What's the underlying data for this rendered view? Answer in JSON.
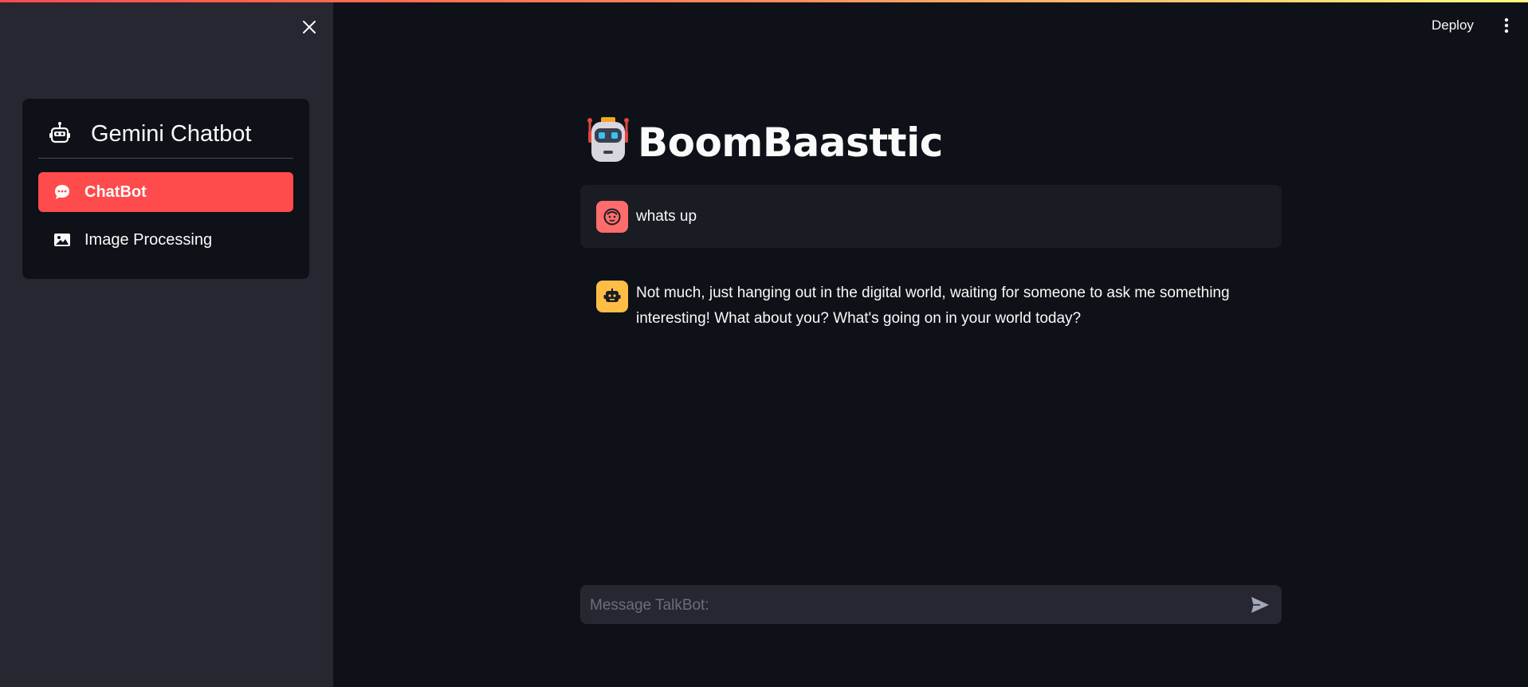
{
  "colors": {
    "accent": "#ff4b4b",
    "background": "#0e1117",
    "sidebar_background": "#262730",
    "user_avatar": "#ff6c6c",
    "bot_avatar": "#ffbd45"
  },
  "sidebar": {
    "close_icon": "close-icon",
    "menu_title": "Gemini Chatbot",
    "menu_title_icon": "robot-icon",
    "items": [
      {
        "label": "ChatBot",
        "icon": "chat-bubble-icon",
        "active": true
      },
      {
        "label": "Image Processing",
        "icon": "image-icon",
        "active": false
      }
    ]
  },
  "toolbar": {
    "deploy_label": "Deploy",
    "more_icon": "more-vertical-icon"
  },
  "main": {
    "title": "BoomBaasttic",
    "title_icon": "robot-emoji-icon"
  },
  "messages": [
    {
      "role": "user",
      "avatar": "user-face-icon",
      "text": "whats up"
    },
    {
      "role": "assistant",
      "avatar": "bot-icon",
      "text": "Not much, just hanging out in the digital world, waiting for someone to ask me something interesting! What about you? What's going on in your world today?"
    }
  ],
  "chat_input": {
    "placeholder": "Message TalkBot:",
    "value": "",
    "send_icon": "send-icon"
  }
}
